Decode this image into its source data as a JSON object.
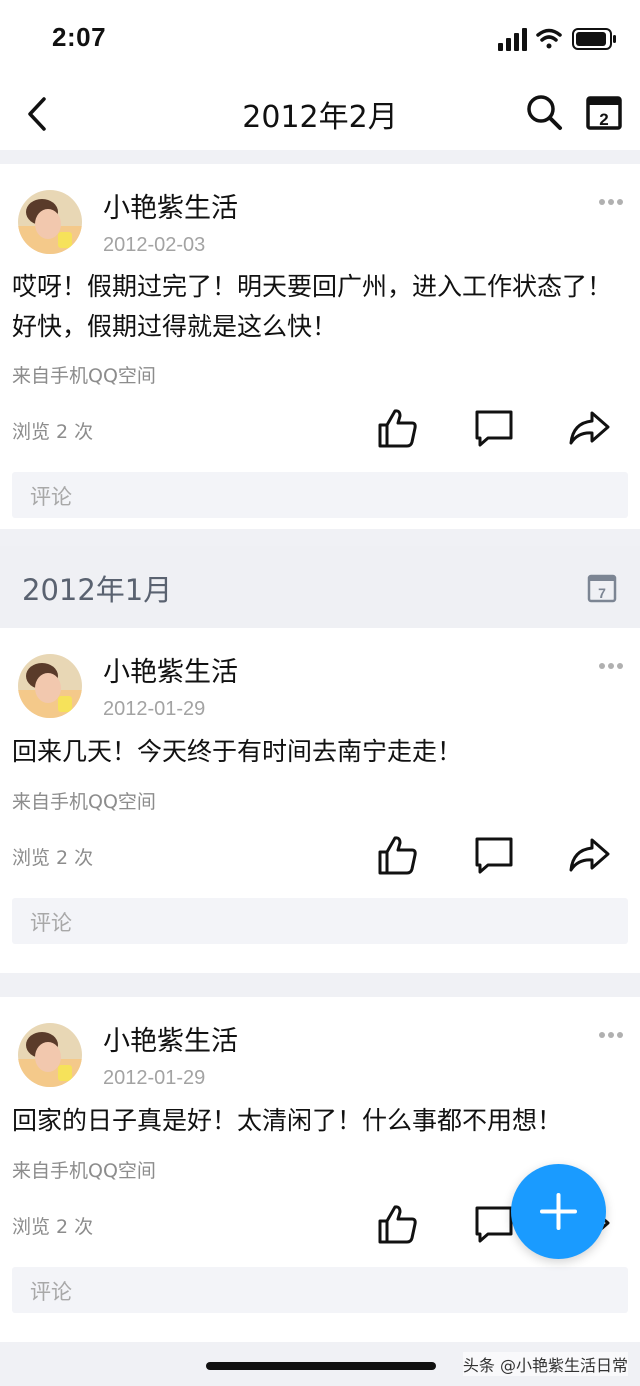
{
  "status": {
    "time": "2:07"
  },
  "nav": {
    "title": "2012年2月",
    "calendar_day": "2"
  },
  "posts": [
    {
      "author": "小艳紫生活",
      "date": "2012-02-03",
      "text": "哎呀！假期过完了！明天要回广州，进入工作状态了！好快，假期过得就是这么快！",
      "source": "来自手机QQ空间",
      "views": "浏览 2 次",
      "comment_placeholder": "评论"
    },
    {
      "author": "小艳紫生活",
      "date": "2012-01-29",
      "text": "回来几天！今天终于有时间去南宁走走！",
      "source": "来自手机QQ空间",
      "views": "浏览 2 次",
      "comment_placeholder": "评论"
    },
    {
      "author": "小艳紫生活",
      "date": "2012-01-29",
      "text": "回家的日子真是好！太清闲了！什么事都不用想！",
      "source": "来自手机QQ空间",
      "views": "浏览 2 次",
      "comment_placeholder": "评论"
    }
  ],
  "month_header": {
    "title": "2012年1月",
    "calendar_day": "7"
  },
  "watermark": "头条 @小艳紫生活日常",
  "colors": {
    "accent": "#1a9bff",
    "secondary_text": "#8c8c8c",
    "background": "#f0f1f5"
  },
  "icons": [
    "back-icon",
    "search-icon",
    "calendar-icon",
    "more-icon",
    "like-icon",
    "comment-icon",
    "share-icon",
    "add-icon"
  ]
}
